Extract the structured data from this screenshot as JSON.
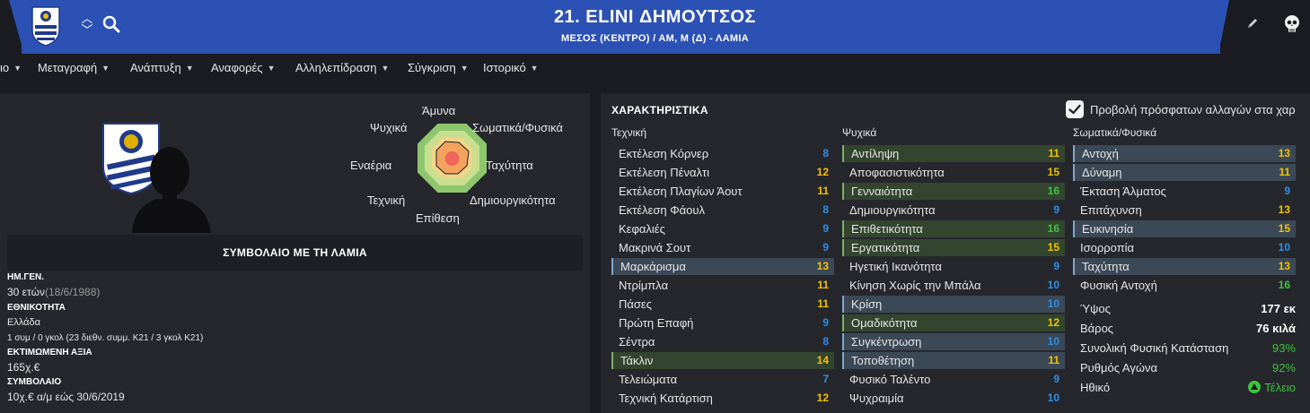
{
  "header": {
    "title": "21. ELINI ΔΗΜΟΥΤΣΟΣ",
    "subtitle": "ΜΕΣΟΣ (ΚΕΝΤΡΟ) / ΑΜ, Μ (Δ) - ΛΑΜΙΑ",
    "colors": {
      "bar": "#2c51b4",
      "background": "#1b1c21"
    }
  },
  "nav": {
    "items": [
      {
        "label": "ιο"
      },
      {
        "label": "Μεταγραφή"
      },
      {
        "label": "Ανάπτυξη"
      },
      {
        "label": "Αναφορές"
      },
      {
        "label": "Αλληλεπίδραση"
      },
      {
        "label": "Σύγκριση"
      },
      {
        "label": "Ιστορικό"
      }
    ]
  },
  "radar": {
    "labels": {
      "defence": "Άμυνα",
      "physical": "Σωματικά/Φυσικά",
      "speed": "Ταχύτητα",
      "creativity": "Δημιουργικότητα",
      "attack": "Επίθεση",
      "technique": "Τεχνική",
      "aerial": "Εναέρια",
      "mental": "Ψυχικά"
    }
  },
  "contract_box": {
    "label": "ΣΥΜΒΟΛΑΙΟ ΜΕ ΤΗ ΛΑΜΙΑ"
  },
  "info": {
    "dob_label": "ΗΜ.ΓΕΝ.",
    "age": "30 ετών",
    "dob": "(18/6/1988)",
    "nationality_label": "ΕΘΝΙΚΟΤΗΤΑ",
    "nationality": "Ελλάδα",
    "caps": "1 συμ / 0 γκολ (23 διεθν. συμμ. Κ21 / 3 γκολ Κ21)",
    "value_label": "ΕΚΤΙΜΩΜΕΝΗ ΑΞΙΑ",
    "value": "165χ.€",
    "contract_label": "ΣΥΜΒΟΛΑΙΟ",
    "contract": "10χ.€ α/μ εώς 30/6/2019"
  },
  "attributes": {
    "title": "ΧΑΡΑΚΤΗΡΙΣΤΙΚΑ",
    "recent_changes_label": "Προβολή πρόσφατων αλλαγών στα χαρ",
    "recent_changes_checked": true,
    "technical": {
      "header": "Τεχνική",
      "rows": [
        {
          "name": "Εκτέλεση Κόρνερ",
          "value": "8",
          "hl": ""
        },
        {
          "name": "Εκτέλεση Πέναλτι",
          "value": "12",
          "hl": ""
        },
        {
          "name": "Εκτέλεση Πλαγίων Άουτ",
          "value": "11",
          "hl": ""
        },
        {
          "name": "Εκτέλεση Φάουλ",
          "value": "8",
          "hl": ""
        },
        {
          "name": "Κεφαλιές",
          "value": "9",
          "hl": ""
        },
        {
          "name": "Μακρινά Σουτ",
          "value": "9",
          "hl": ""
        },
        {
          "name": "Μαρκάρισμα",
          "value": "13",
          "hl": "blue"
        },
        {
          "name": "Ντρίμπλα",
          "value": "11",
          "hl": ""
        },
        {
          "name": "Πάσες",
          "value": "11",
          "hl": ""
        },
        {
          "name": "Πρώτη Επαφή",
          "value": "9",
          "hl": ""
        },
        {
          "name": "Σέντρα",
          "value": "8",
          "hl": ""
        },
        {
          "name": "Τάκλιν",
          "value": "14",
          "hl": "green"
        },
        {
          "name": "Τελειώματα",
          "value": "7",
          "hl": ""
        },
        {
          "name": "Τεχνική Κατάρτιση",
          "value": "12",
          "hl": ""
        }
      ]
    },
    "mental": {
      "header": "Ψυχικά",
      "rows": [
        {
          "name": "Αντίληψη",
          "value": "11",
          "hl": "green"
        },
        {
          "name": "Αποφασιστικότητα",
          "value": "15",
          "hl": ""
        },
        {
          "name": "Γενναιότητα",
          "value": "16",
          "hl": "green"
        },
        {
          "name": "Δημιουργικότητα",
          "value": "9",
          "hl": ""
        },
        {
          "name": "Επιθετικότητα",
          "value": "16",
          "hl": "green"
        },
        {
          "name": "Εργατικότητα",
          "value": "15",
          "hl": "green"
        },
        {
          "name": "Ηγετική Ικανότητα",
          "value": "9",
          "hl": ""
        },
        {
          "name": "Κίνηση Χωρίς την Μπάλα",
          "value": "10",
          "hl": ""
        },
        {
          "name": "Κρίση",
          "value": "10",
          "hl": "blue"
        },
        {
          "name": "Ομαδικότητα",
          "value": "12",
          "hl": "green"
        },
        {
          "name": "Συγκέντρωση",
          "value": "10",
          "hl": "blue"
        },
        {
          "name": "Τοποθέτηση",
          "value": "11",
          "hl": "blue"
        },
        {
          "name": "Φυσικό Ταλέντο",
          "value": "9",
          "hl": ""
        },
        {
          "name": "Ψυχραιμία",
          "value": "10",
          "hl": ""
        }
      ]
    },
    "physical": {
      "header": "Σωματικά/Φυσικά",
      "rows": [
        {
          "name": "Αντοχή",
          "value": "13",
          "hl": "blue"
        },
        {
          "name": "Δύναμη",
          "value": "11",
          "hl": "blue"
        },
        {
          "name": "Έκταση Άλματος",
          "value": "9",
          "hl": ""
        },
        {
          "name": "Επιτάχυνση",
          "value": "13",
          "hl": ""
        },
        {
          "name": "Ευκινησία",
          "value": "15",
          "hl": "blue"
        },
        {
          "name": "Ισορροπία",
          "value": "10",
          "hl": ""
        },
        {
          "name": "Ταχύτητα",
          "value": "13",
          "hl": "blue"
        },
        {
          "name": "Φυσική Αντοχή",
          "value": "16",
          "hl": ""
        }
      ]
    }
  },
  "stats": {
    "height_label": "Ύψος",
    "height": "177 εκ",
    "weight_label": "Βάρος",
    "weight": "76 κιλά",
    "condition_label": "Συνολική Φυσική Κατάσταση",
    "condition": "93%",
    "sharpness_label": "Ρυθμός Αγώνα",
    "sharpness": "92%",
    "morale_label": "Ηθικό",
    "morale": "Τέλειο"
  }
}
